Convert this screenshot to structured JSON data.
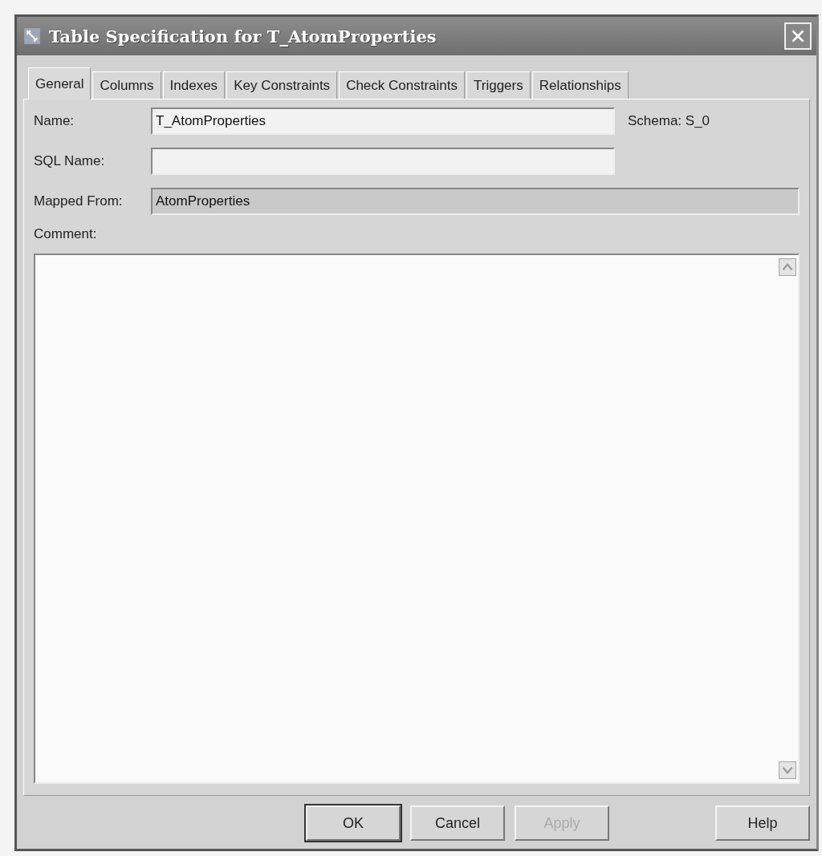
{
  "window": {
    "title": "Table Specification for T_AtomProperties"
  },
  "tabs": [
    {
      "label": "General",
      "selected": true
    },
    {
      "label": "Columns",
      "selected": false
    },
    {
      "label": "Indexes",
      "selected": false
    },
    {
      "label": "Key Constraints",
      "selected": false
    },
    {
      "label": "Check Constraints",
      "selected": false
    },
    {
      "label": "Triggers",
      "selected": false
    },
    {
      "label": "Relationships",
      "selected": false
    }
  ],
  "fields": [
    {
      "label": "Name:",
      "value": "T_AtomProperties",
      "readonly": false
    },
    {
      "label": "SQL Name:",
      "readonly": false
    },
    {
      "label": "Mapped From:",
      "value": "AtomProperties",
      "readonly": true
    }
  ],
  "schema": {
    "label": "Schema:",
    "value": "S_0"
  },
  "comment": {
    "label": "Comment:"
  },
  "buttons": [
    {
      "label": "OK",
      "disabled": false
    },
    {
      "label": "Cancel",
      "disabled": false
    },
    {
      "label": "Apply",
      "disabled": true
    },
    {
      "label": "Help",
      "disabled": false
    }
  ]
}
